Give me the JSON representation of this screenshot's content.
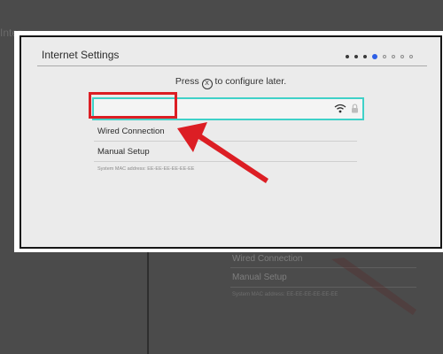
{
  "background": {
    "fragment_title": "Inter",
    "items": [
      "Wired Connection",
      "Manual Setup"
    ],
    "mac_line": "System MAC address: EE-EE-EE-EE-EE-EE"
  },
  "screen": {
    "title": "Internet Settings",
    "pager": {
      "total_steps": 8,
      "current_step": 4
    },
    "hint": {
      "prefix": "Press ",
      "button": "X",
      "suffix": " to configure later."
    },
    "networks": [
      {
        "name": "",
        "secured": true
      }
    ],
    "menu": {
      "wired_connection": "Wired Connection",
      "manual_setup": "Manual Setup"
    },
    "mac_line": "System MAC address: EE-EE-EE-EE-EE-EE"
  },
  "annotation": {
    "color": "#dc1e24"
  },
  "colors": {
    "accent": "#3fd1c8",
    "pager_current": "#2e5fe6",
    "annotation_red": "#dc1e24"
  },
  "icons": [
    "wifi-icon",
    "lock-icon",
    "x-button-icon"
  ]
}
